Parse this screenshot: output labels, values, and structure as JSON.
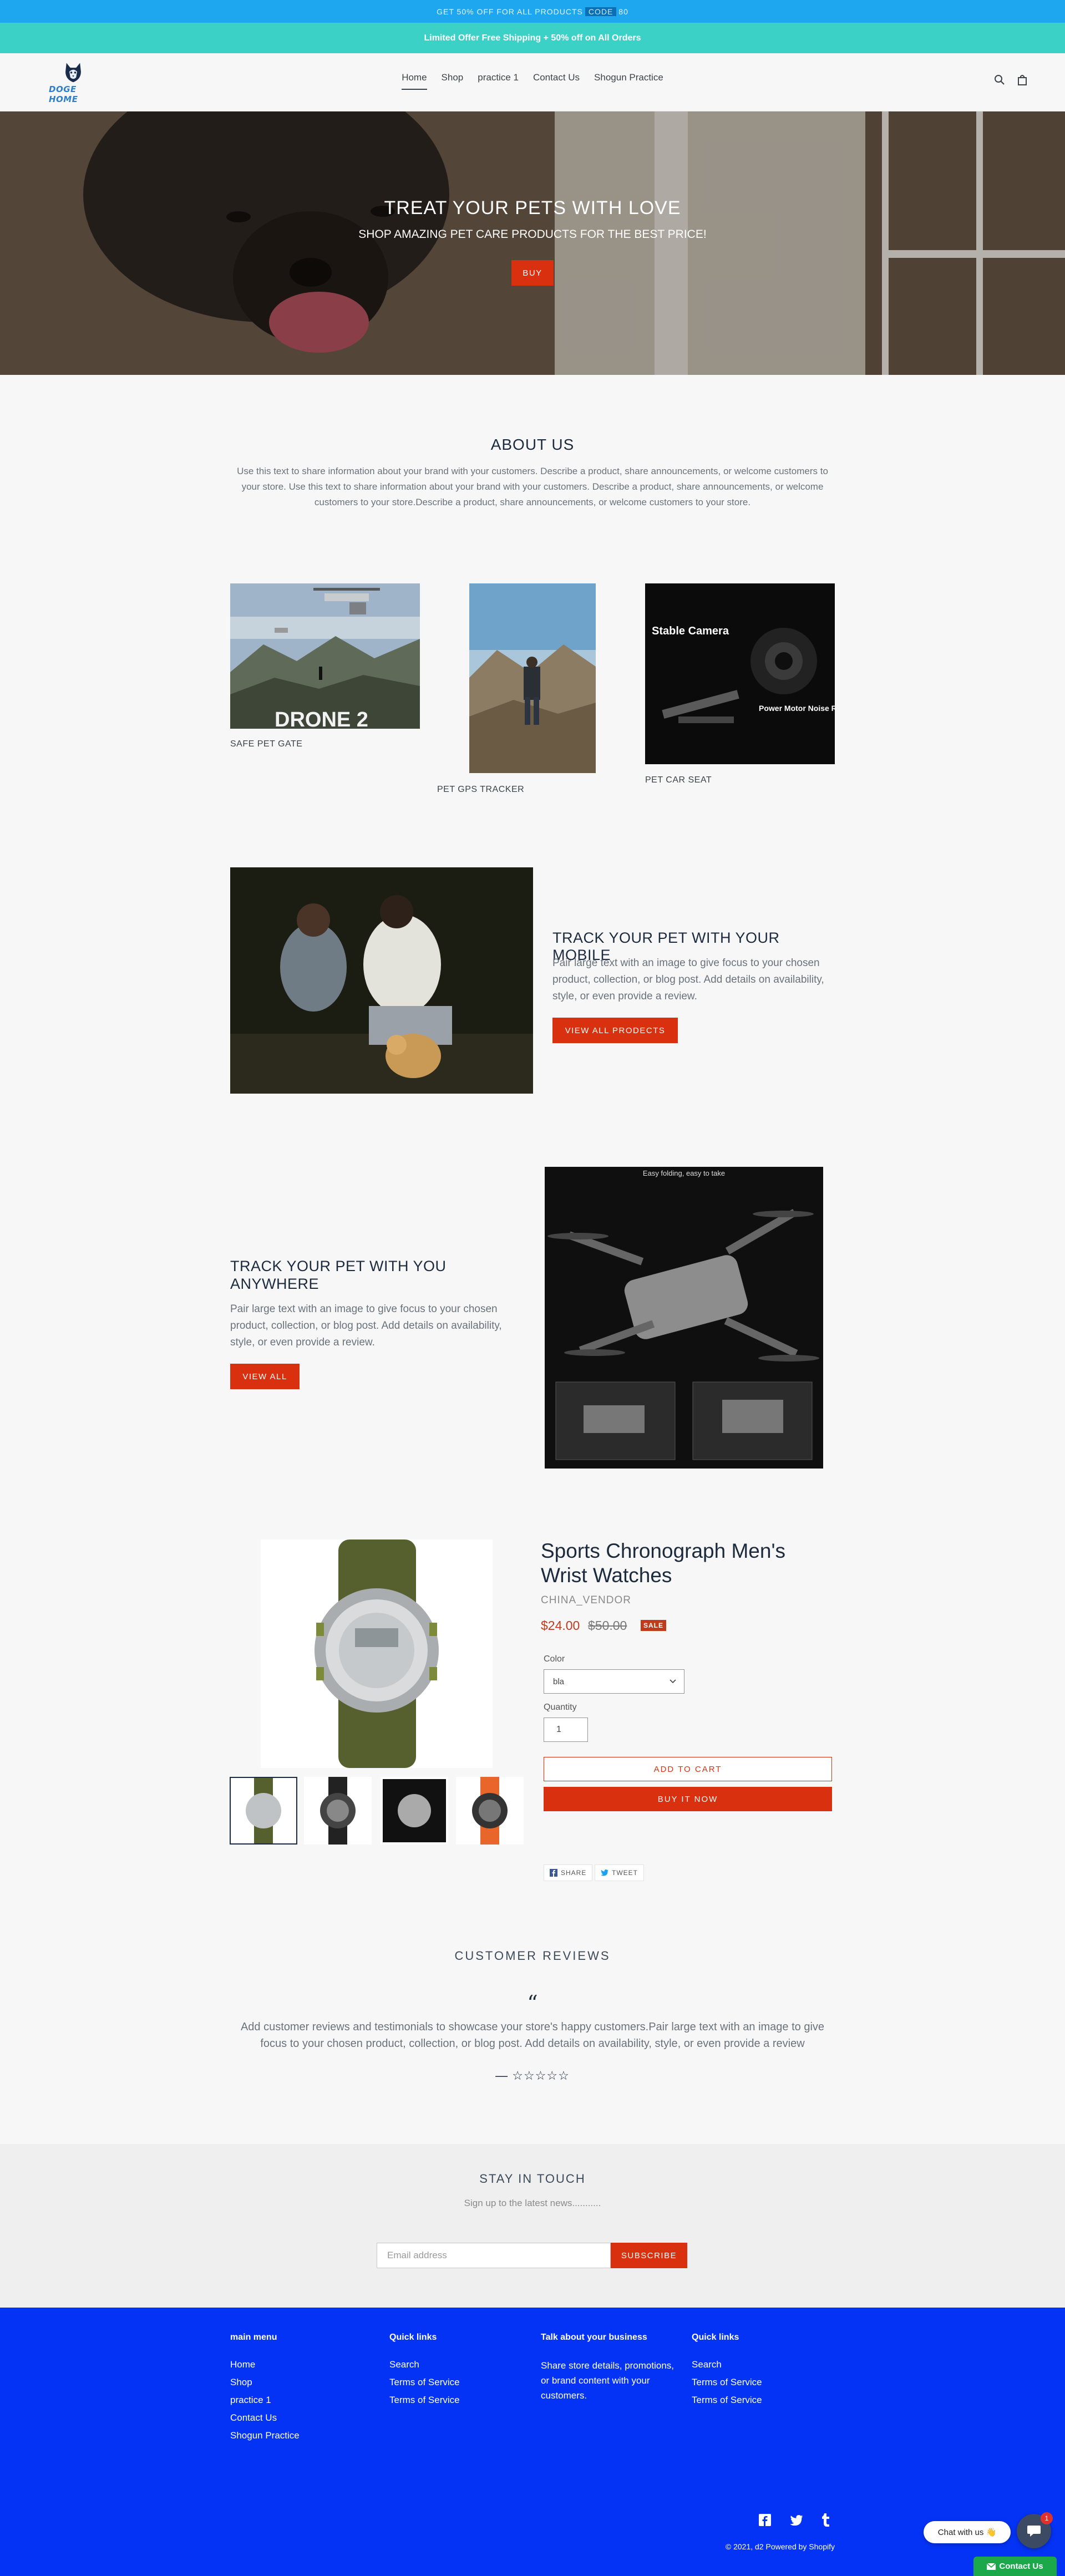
{
  "announcement": {
    "promo_text": "GET 50% OFF FOR ALL PRODUCTS",
    "promo_code": "CODE",
    "promo_suffix": "80",
    "shipping_text": "Limited Offer Free Shipping + 50% off on All Orders"
  },
  "header": {
    "logo_text": "DOGE HOME",
    "nav": [
      "Home",
      "Shop",
      "practice 1",
      "Contact Us",
      "Shogun Practice"
    ],
    "search_icon": "search-icon",
    "cart_icon": "bag-icon"
  },
  "hero": {
    "title": "TREAT YOUR PETS WITH LOVE",
    "subtitle": "SHOP AMAZING PET CARE PRODUCTS FOR THE BEST PRICE!",
    "button": "BUY"
  },
  "about": {
    "title": "ABOUT US",
    "text": "Use this text to share information about your brand with your customers. Describe a product, share announcements, or welcome customers to your store. Use this text to share information about your brand with your customers. Describe a product, share announcements, or welcome customers to your store.Describe a product, share announcements, or welcome customers to your store."
  },
  "collections": [
    {
      "label": "SAFE PET GATE",
      "image_text": "DRONE 2"
    },
    {
      "label": "PET GPS TRACKER",
      "image_text": ""
    },
    {
      "label": "PET CAR SEAT",
      "image_text": "Stable Camera",
      "image_text2": "Power Motor Noise Reduction Bladea"
    }
  ],
  "feature1": {
    "title": "TRACK YOUR PET WITH YOUR MOBILE",
    "text": "Pair large text with an image to give focus to your chosen product, collection, or blog post. Add details on availability, style, or even provide a review.",
    "button": "VIEW ALL PRODECTS"
  },
  "feature2": {
    "title": "TRACK YOUR PET WITH YOU ANYWHERE",
    "text": "Pair large text with an image to give focus to your chosen product, collection, or blog post. Add details on availability, style, or even provide a review.",
    "button": "VIEW ALL",
    "image_caption": "Easy folding, easy to take"
  },
  "product": {
    "title": "Sports Chronograph Men's Wrist Watches",
    "vendor": "CHINA_VENDOR",
    "price": "$24.00",
    "compare_price": "$50.00",
    "badge": "SALE",
    "color_label": "Color",
    "color_value": "bla",
    "quantity_label": "Quantity",
    "quantity_value": "1",
    "add_to_cart": "ADD TO CART",
    "buy_now": "BUY IT NOW",
    "share": "SHARE",
    "tweet": "TWEET"
  },
  "reviews": {
    "title": "CUSTOMER REVIEWS",
    "quote_mark": "“",
    "text": "Add customer reviews and testimonials to showcase your store's happy customers.Pair large text with an image to give focus to your chosen product, collection, or blog post. Add details on availability, style, or even provide a review",
    "stars": "— ☆☆☆☆☆"
  },
  "newsletter": {
    "title": "STAY IN TOUCH",
    "subtitle": "Sign up to the latest news...........",
    "placeholder": "Email address",
    "button": "SUBSCRIBE"
  },
  "footer": {
    "col1": {
      "heading": "main menu",
      "links": [
        "Home",
        "Shop",
        "practice 1",
        "Contact Us",
        "Shogun Practice"
      ]
    },
    "col2": {
      "heading": "Quick links",
      "links": [
        "Search",
        "Terms of Service",
        "Terms of Service"
      ]
    },
    "col3": {
      "heading": "Talk about your business",
      "text": "Share store details, promotions, or brand content with your customers."
    },
    "col4": {
      "heading": "Quick links",
      "links": [
        "Search",
        "Terms of Service",
        "Terms of Service"
      ]
    },
    "copyright": "© 2021, d2 Powered by Shopify",
    "social": [
      "facebook-icon",
      "twitter-icon",
      "tumblr-icon"
    ]
  },
  "chat": {
    "bubble": "Chat with us 👋",
    "badge": "1",
    "contact_tab": "Contact Us"
  },
  "colors": {
    "accent": "#d9300f",
    "topbar": "#1ea7ee",
    "shipping_bar": "#3bd1c6",
    "footer": "#0433f5"
  }
}
